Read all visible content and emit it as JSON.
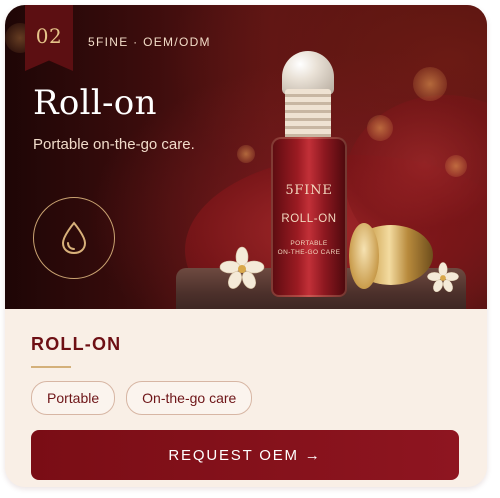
{
  "card": {
    "index_badge": "02",
    "brand_line": "5FINE · OEM/ODM",
    "title": "Roll-on",
    "subtitle": "Portable on-the-go care.",
    "icon": "droplet-icon",
    "product": {
      "brand": "5FINE",
      "name": "ROLL-ON",
      "tagline_line1": "PORTABLE",
      "tagline_line2": "ON-THE-GO CARE"
    },
    "section_title": "ROLL-ON",
    "tags": [
      {
        "label": "Portable"
      },
      {
        "label": "On-the-go care"
      }
    ],
    "cta_label": "REQUEST OEM →"
  },
  "colors": {
    "accent": "#7a0d15",
    "gold": "#d4b07a",
    "background": "#f9efe6"
  }
}
